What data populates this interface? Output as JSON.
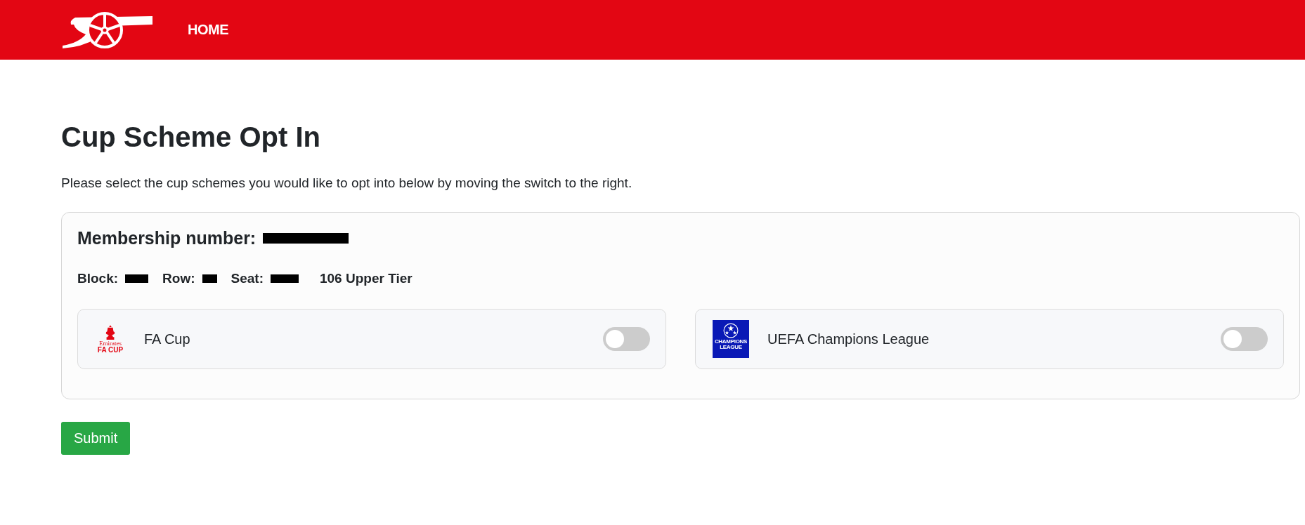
{
  "nav": {
    "links": [
      {
        "label": "HOME"
      }
    ]
  },
  "title": "Cup Scheme Opt In",
  "intro": "Please select the cup schemes you would like to opt into below by moving the switch to the right.",
  "card": {
    "membership_label": "Membership number:",
    "seat_info": [
      {
        "label": "Block:"
      },
      {
        "label": "Row:"
      },
      {
        "label": "Seat:"
      }
    ],
    "stand": "106 Upper Tier",
    "schemes": [
      {
        "kind": "fa",
        "name": "FA Cup",
        "logo_text": [
          "Emirates",
          "FA CUP"
        ],
        "on": false
      },
      {
        "kind": "ucl",
        "name": "UEFA Champions League",
        "logo_text": [
          "CHAMPIONS",
          "LEAGUE"
        ],
        "on": false
      }
    ]
  },
  "submit": "Submit"
}
